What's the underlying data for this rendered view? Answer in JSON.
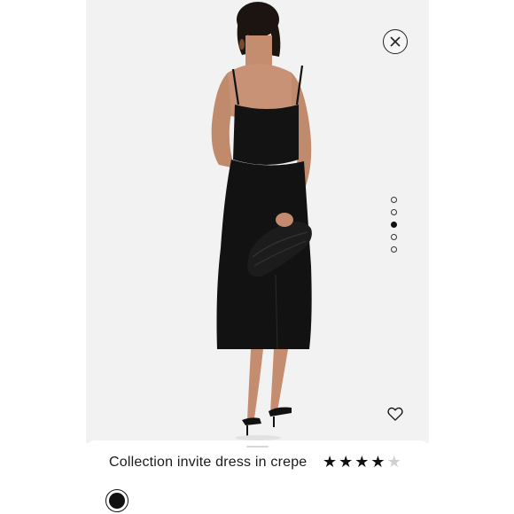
{
  "product": {
    "title": "Collection invite dress in crepe",
    "rating": 4,
    "rating_max": 5,
    "selected_color": "#111111"
  },
  "gallery": {
    "image_count": 5,
    "active_index": 2
  },
  "icons": {
    "close": "close-icon",
    "favorite": "heart-icon",
    "star": "star-icon"
  },
  "colors": {
    "background": "#f2f2f2",
    "dress": "#111111",
    "skin": "#c79275"
  }
}
